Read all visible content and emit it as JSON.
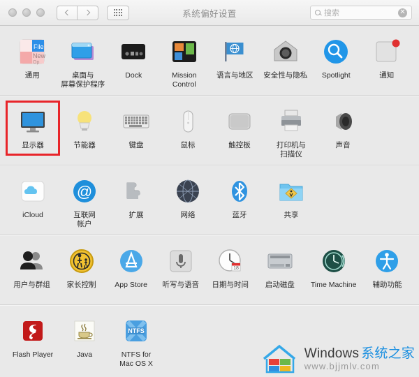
{
  "window": {
    "title": "系统偏好设置",
    "traffic_lights": [
      "close",
      "minimize",
      "zoom"
    ],
    "nav_back_label": "‹",
    "nav_forward_label": "›",
    "grid_button_label": "show-all"
  },
  "search": {
    "placeholder": "搜索",
    "value": "",
    "clear_label": "✕"
  },
  "highlight": {
    "color": "#e8252a",
    "target": "显示器"
  },
  "rows": [
    {
      "panes": [
        {
          "label": "通用",
          "icon": "general-icon"
        },
        {
          "label": "桌面与\n屏幕保护程序",
          "icon": "desktop-screensaver-icon"
        },
        {
          "label": "Dock",
          "icon": "dock-icon"
        },
        {
          "label": "Mission\nControl",
          "icon": "mission-control-icon"
        },
        {
          "label": "语言与地区",
          "icon": "language-region-icon"
        },
        {
          "label": "安全性与隐私",
          "icon": "security-privacy-icon"
        },
        {
          "label": "Spotlight",
          "icon": "spotlight-icon"
        },
        {
          "label": "通知",
          "icon": "notifications-icon"
        }
      ]
    },
    {
      "panes": [
        {
          "label": "显示器",
          "icon": "displays-icon",
          "highlighted": true
        },
        {
          "label": "节能器",
          "icon": "energy-saver-icon"
        },
        {
          "label": "键盘",
          "icon": "keyboard-icon"
        },
        {
          "label": "鼠标",
          "icon": "mouse-icon"
        },
        {
          "label": "触控板",
          "icon": "trackpad-icon"
        },
        {
          "label": "打印机与\n扫描仪",
          "icon": "printers-scanners-icon"
        },
        {
          "label": "声音",
          "icon": "sound-icon"
        }
      ]
    },
    {
      "panes": [
        {
          "label": "iCloud",
          "icon": "icloud-icon"
        },
        {
          "label": "互联网\n帐户",
          "icon": "internet-accounts-icon"
        },
        {
          "label": "扩展",
          "icon": "extensions-icon"
        },
        {
          "label": "网络",
          "icon": "network-icon"
        },
        {
          "label": "蓝牙",
          "icon": "bluetooth-icon"
        },
        {
          "label": "共享",
          "icon": "sharing-icon"
        }
      ]
    },
    {
      "panes": [
        {
          "label": "用户与群组",
          "icon": "users-groups-icon"
        },
        {
          "label": "家长控制",
          "icon": "parental-controls-icon"
        },
        {
          "label": "App Store",
          "icon": "app-store-icon"
        },
        {
          "label": "听写与语音",
          "icon": "dictation-speech-icon"
        },
        {
          "label": "日期与时间",
          "icon": "date-time-icon"
        },
        {
          "label": "启动磁盘",
          "icon": "startup-disk-icon"
        },
        {
          "label": "Time Machine",
          "icon": "time-machine-icon"
        },
        {
          "label": "辅助功能",
          "icon": "accessibility-icon"
        }
      ]
    },
    {
      "panes": [
        {
          "label": "Flash Player",
          "icon": "flash-player-icon"
        },
        {
          "label": "Java",
          "icon": "java-icon"
        },
        {
          "label": "NTFS for\nMac OS X",
          "icon": "ntfs-icon"
        }
      ]
    }
  ],
  "watermark": {
    "brand_en": "Windows",
    "brand_cn": "系统之家",
    "url": "www.bjjmlv.com"
  }
}
